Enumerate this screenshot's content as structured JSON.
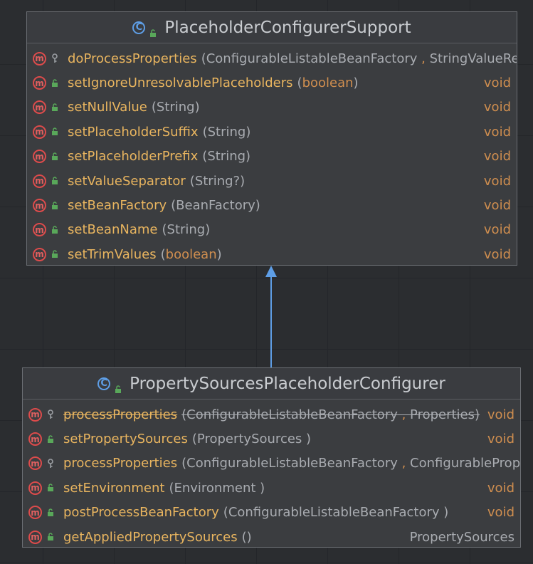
{
  "superclass": {
    "class_icon": "C",
    "name": "PlaceholderConfigurerSupport",
    "methods": [
      {
        "icon": "m",
        "visibility": "protected",
        "name": "doProcessProperties",
        "params": [
          {
            "text": "ConfigurableListableBeanFactory",
            "kw": false
          },
          {
            "text": " , ",
            "kw": true
          },
          {
            "text": "StringValueResolver",
            "kw": false
          }
        ],
        "close": ")",
        "ret": ""
      },
      {
        "icon": "m",
        "visibility": "public",
        "name": "setIgnoreUnresolvablePlaceholders",
        "params": [
          {
            "text": "boolean",
            "kw": true
          }
        ],
        "close": ")",
        "ret": "void"
      },
      {
        "icon": "m",
        "visibility": "public",
        "name": "setNullValue",
        "params": [
          {
            "text": "String",
            "kw": false
          }
        ],
        "close": ")",
        "ret": "void"
      },
      {
        "icon": "m",
        "visibility": "public",
        "name": "setPlaceholderSuffix",
        "params": [
          {
            "text": "String",
            "kw": false
          }
        ],
        "close": ")",
        "ret": "void"
      },
      {
        "icon": "m",
        "visibility": "public",
        "name": "setPlaceholderPrefix",
        "params": [
          {
            "text": "String",
            "kw": false
          }
        ],
        "close": ")",
        "ret": "void"
      },
      {
        "icon": "m",
        "visibility": "public",
        "name": "setValueSeparator",
        "params": [
          {
            "text": "String?",
            "kw": false
          }
        ],
        "close": ")",
        "ret": "void"
      },
      {
        "icon": "m",
        "visibility": "public",
        "name": "setBeanFactory",
        "params": [
          {
            "text": "BeanFactory",
            "kw": false
          }
        ],
        "close": ")",
        "ret": "void"
      },
      {
        "icon": "m",
        "visibility": "public",
        "name": "setBeanName",
        "params": [
          {
            "text": "String",
            "kw": false
          }
        ],
        "close": ")",
        "ret": "void"
      },
      {
        "icon": "m",
        "visibility": "public",
        "name": "setTrimValues",
        "params": [
          {
            "text": "boolean",
            "kw": true
          }
        ],
        "close": ")",
        "ret": "void"
      }
    ]
  },
  "subclass": {
    "class_icon": "C",
    "name": "PropertySourcesPlaceholderConfigurer",
    "methods": [
      {
        "icon": "m",
        "visibility": "protected",
        "deprecated": true,
        "name": "processProperties",
        "params": [
          {
            "text": "ConfigurableListableBeanFactory",
            "kw": false
          },
          {
            "text": " , ",
            "kw": true
          },
          {
            "text": "Properties",
            "kw": false
          }
        ],
        "close": ")",
        "ret": "void"
      },
      {
        "icon": "m",
        "visibility": "public",
        "name": "setPropertySources",
        "params": [
          {
            "text": "PropertySources",
            "kw": false
          }
        ],
        "close": " )",
        "ret": "void"
      },
      {
        "icon": "m",
        "visibility": "protected",
        "name": "processProperties",
        "params": [
          {
            "text": "ConfigurableListableBeanFactory",
            "kw": false
          },
          {
            "text": " , ",
            "kw": true
          },
          {
            "text": "ConfigurablePropertyResolver",
            "kw": false
          }
        ],
        "close": ")",
        "ret": ""
      },
      {
        "icon": "m",
        "visibility": "public",
        "name": "setEnvironment",
        "params": [
          {
            "text": "Environment",
            "kw": false
          }
        ],
        "close": " )",
        "ret": "void"
      },
      {
        "icon": "m",
        "visibility": "public",
        "name": "postProcessBeanFactory",
        "params": [
          {
            "text": "ConfigurableListableBeanFactory",
            "kw": false
          }
        ],
        "close": " )",
        "ret": "void"
      },
      {
        "icon": "m",
        "visibility": "public",
        "name": "getAppliedPropertySources",
        "params": [],
        "close": ")",
        "ret": "PropertySources",
        "ret_is_type": true
      }
    ]
  },
  "relation": {
    "type": "extends",
    "color": "#5e9ee6"
  },
  "colors": {
    "method": "#e9b55f",
    "keyword": "#cf8e4f",
    "type": "#a9acb1",
    "class_icon": "#5e9ee6",
    "method_icon": "#dd4b4b",
    "public": "#59a85a",
    "protected": "#9a9da2"
  }
}
